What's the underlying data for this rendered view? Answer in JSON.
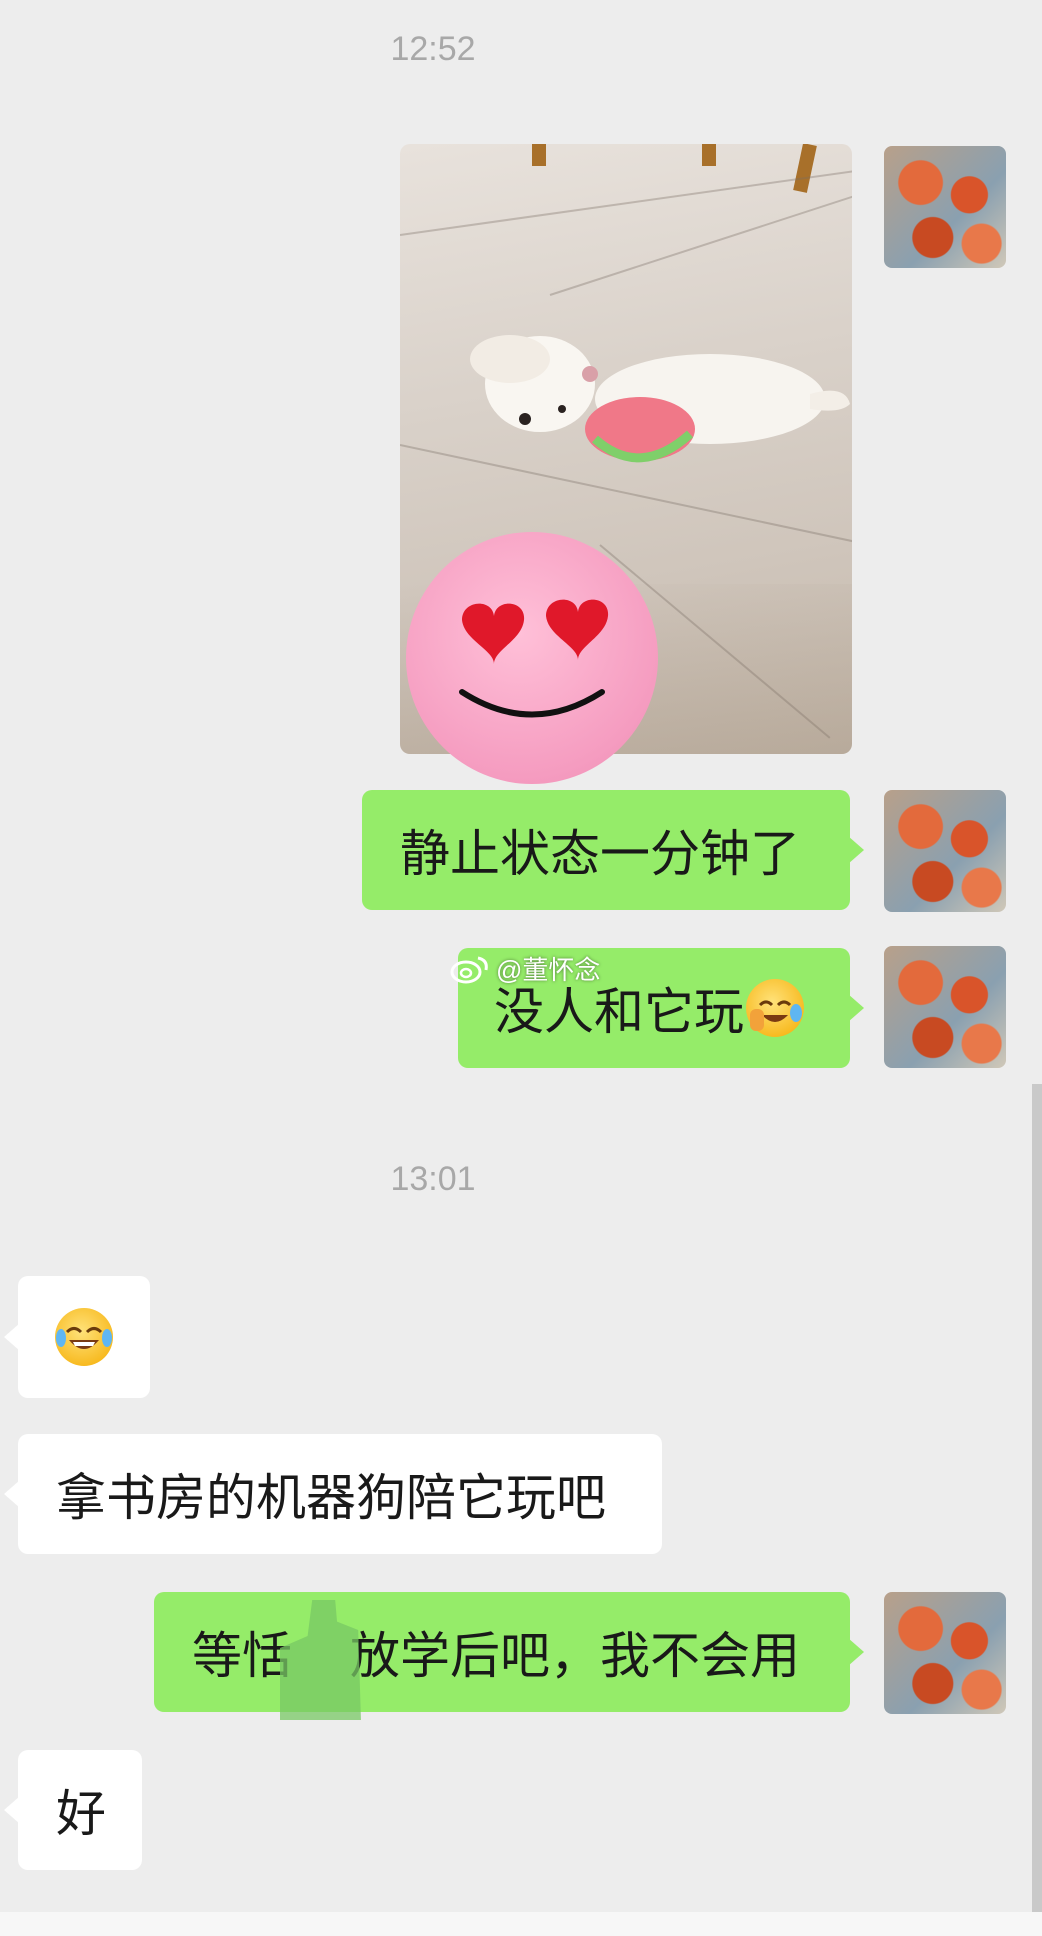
{
  "chat": {
    "timestamps": [
      "12:52",
      "13:01"
    ],
    "watermark": "@董怀念",
    "messages": [
      {
        "from": "me",
        "type": "image",
        "description_icon": "dog-photo"
      },
      {
        "from": "me",
        "type": "text",
        "text": "静止状态一分钟了"
      },
      {
        "from": "me",
        "type": "text",
        "text": "没人和它玩",
        "emoji": "crying-laughing-face"
      },
      {
        "from": "other",
        "type": "emoji",
        "emoji": "tears-of-joy-face"
      },
      {
        "from": "other",
        "type": "text",
        "text": "拿书房的机器狗陪它玩吧"
      },
      {
        "from": "me",
        "type": "text",
        "text": "等恬",
        "text_tail": "放学后吧，我不会用"
      },
      {
        "from": "other",
        "type": "text",
        "text": "好"
      }
    ]
  },
  "colors": {
    "background": "#ededed",
    "my_bubble": "#95ec69",
    "other_bubble": "#ffffff",
    "timestamp": "#a8a8a8"
  }
}
